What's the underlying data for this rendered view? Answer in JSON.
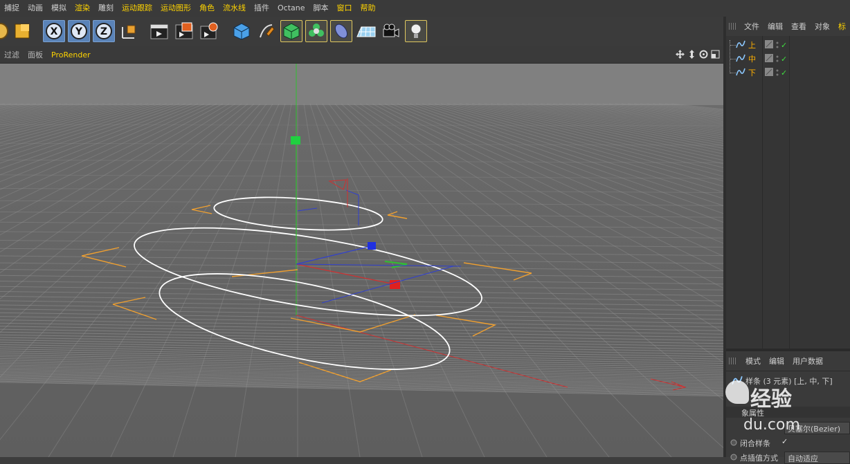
{
  "menu": {
    "items": [
      {
        "label": "捕捉",
        "highlight": false
      },
      {
        "label": "动画",
        "highlight": false
      },
      {
        "label": "模拟",
        "highlight": false
      },
      {
        "label": "渲染",
        "highlight": true
      },
      {
        "label": "雕刻",
        "highlight": false
      },
      {
        "label": "运动跟踪",
        "highlight": true
      },
      {
        "label": "运动图形",
        "highlight": true
      },
      {
        "label": "角色",
        "highlight": true
      },
      {
        "label": "流水线",
        "highlight": true
      },
      {
        "label": "插件",
        "highlight": false
      },
      {
        "label": "Octane",
        "highlight": false
      },
      {
        "label": "脚本",
        "highlight": false
      },
      {
        "label": "窗口",
        "highlight": true
      },
      {
        "label": "帮助",
        "highlight": true
      }
    ]
  },
  "toolbar": {
    "axis_x": "X",
    "axis_y": "Y",
    "axis_z": "Z",
    "icons": [
      "live-select-icon",
      "axis-x-lock-icon",
      "axis-y-lock-icon",
      "axis-z-lock-icon",
      "coordinate-system-icon",
      "render-view-icon",
      "render-picture-viewer-icon",
      "render-settings-icon",
      "cube-primitive-icon",
      "pen-spline-icon",
      "subdivision-icon",
      "cloner-icon",
      "deformer-icon",
      "floor-icon",
      "camera-icon",
      "light-icon"
    ]
  },
  "viewport": {
    "menu": [
      {
        "label": "过滤",
        "highlight": false
      },
      {
        "label": "面板",
        "highlight": false
      },
      {
        "label": "ProRender",
        "highlight": true
      }
    ],
    "nav_icons": [
      "move-view-icon",
      "dolly-view-icon",
      "rotate-view-icon",
      "maximize-view-icon"
    ],
    "colors": {
      "grid": "#9a9a9a",
      "x_axis": "#d03030",
      "y_axis": "#30c030",
      "z_axis": "#3040d0",
      "bounding": "#f0a030",
      "spline": "#ffffff"
    }
  },
  "object_manager": {
    "tabs": [
      "文件",
      "编辑",
      "查看",
      "对象",
      "标"
    ],
    "objects": [
      {
        "name": "上"
      },
      {
        "name": "中"
      },
      {
        "name": "下"
      }
    ]
  },
  "attribute_manager": {
    "tabs": [
      "模式",
      "编辑",
      "用户数据"
    ],
    "selection": "样条 (3 元素) [上, 中, 下]",
    "section": "象属性",
    "type_value": "贝塞尔(Bezier)",
    "closed_label": "闭合样条",
    "closed_checked": "✓",
    "interp_label": "点插值方式",
    "interp_value": "自动适应"
  },
  "watermark": {
    "line1": "经验",
    "line2": "du.com"
  }
}
